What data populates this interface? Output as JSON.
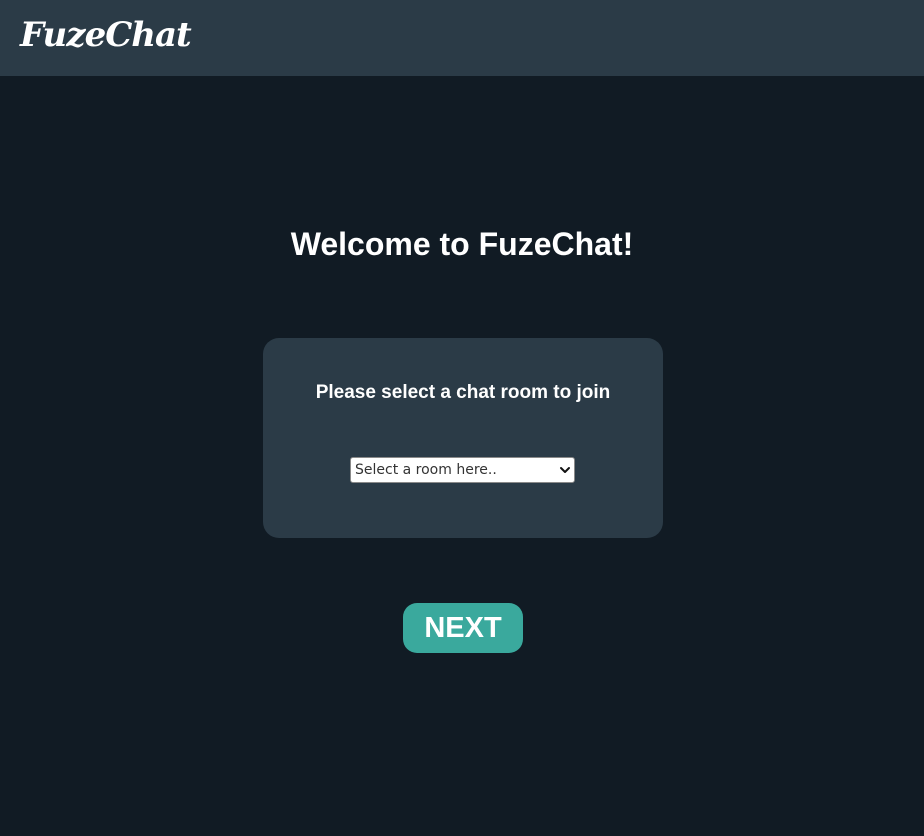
{
  "header": {
    "logo_text": "FuzeChat"
  },
  "main": {
    "welcome_title": "Welcome to FuzeChat!",
    "room_card": {
      "prompt": "Please select a chat room to join",
      "room_select": {
        "selected_value": "Select a room here..",
        "icon": "chevron-down-icon"
      }
    },
    "next_button_label": "NEXT"
  },
  "colors": {
    "page_background": "#111b24",
    "header_background": "#2b3b47",
    "card_background": "#2b3b47",
    "accent_button": "#3aa99d",
    "text_primary": "#ffffff"
  }
}
